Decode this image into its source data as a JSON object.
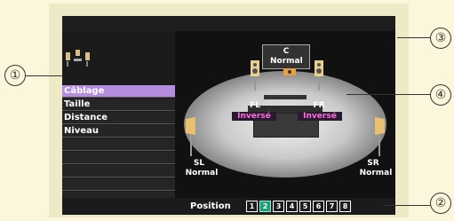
{
  "menu": {
    "items": [
      {
        "label": "Câblage",
        "active": true
      },
      {
        "label": "Taille",
        "active": false
      },
      {
        "label": "Distance",
        "active": false
      },
      {
        "label": "Niveau",
        "active": false
      }
    ]
  },
  "speakers": {
    "c": {
      "name": "C",
      "status": "Normal"
    },
    "fl": {
      "name": "FL",
      "status": "Inversé"
    },
    "fr": {
      "name": "FR",
      "status": "Inversé"
    },
    "sl": {
      "name": "SL",
      "status": "Normal"
    },
    "sr": {
      "name": "SR",
      "status": "Normal"
    }
  },
  "position": {
    "label": "Position",
    "buttons": [
      "1",
      "2",
      "3",
      "4",
      "5",
      "6",
      "7",
      "8"
    ],
    "active_index": 1
  },
  "callouts": {
    "c1": "①",
    "c2": "②",
    "c3": "③",
    "c4": "④"
  },
  "colors": {
    "accent_purple": "#b48ce0",
    "inverse_magenta": "#ff6ee0",
    "active_green": "#1aa07a"
  }
}
